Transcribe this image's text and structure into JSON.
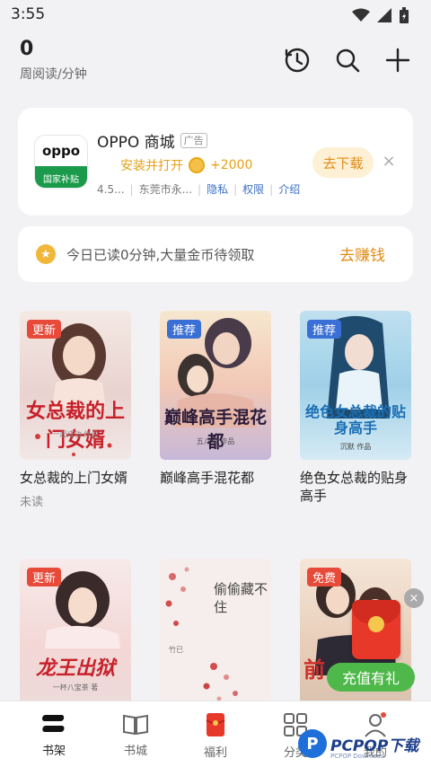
{
  "status_bar": {
    "time": "3:55"
  },
  "header": {
    "weekly_count": "0",
    "weekly_label": "周阅读/分钟",
    "history_icon": "history-clock-icon",
    "search_icon": "search-icon",
    "add_icon": "plus-icon"
  },
  "ad": {
    "logo_text": "oppo",
    "logo_sub": "国家补贴",
    "title": "OPPO 商城",
    "tag": "广告",
    "install_text": "安装并打开",
    "bonus": "+2000",
    "rating": "4.5...",
    "developer": "东莞市永...",
    "privacy": "隐私",
    "permissions": "权限",
    "intro": "介绍",
    "download": "去下载",
    "close": "×"
  },
  "earn": {
    "text": "今日已读0分钟,大量金币待领取",
    "button": "去赚钱"
  },
  "books": [
    {
      "badge": "更新",
      "cover_title": "女总裁的上门女婿",
      "cover_author": "一起成功 作品",
      "title": "女总裁的上门女婿",
      "status": "未读"
    },
    {
      "badge": "推荐",
      "cover_title": "巅峰高手混花都",
      "cover_author": "五八山 作品",
      "title": "巅峰高手混花都",
      "status": ""
    },
    {
      "badge": "推荐",
      "cover_title": "绝色女总裁的贴身高手",
      "cover_author": "沉默 作品",
      "title": "绝色女总裁的贴身高手",
      "status": ""
    },
    {
      "badge": "更新",
      "cover_title": "龙王出狱",
      "cover_author": "一杯八宝茶 著",
      "title": "",
      "status": ""
    },
    {
      "badge": "",
      "cover_title": "偷偷藏不住",
      "cover_author": "竹已",
      "title": "",
      "status": ""
    },
    {
      "badge": "免费",
      "cover_title": "前",
      "cover_author": "",
      "title": "",
      "status": ""
    }
  ],
  "floating": {
    "recharge": "充值有礼",
    "close": "×"
  },
  "tabs": [
    {
      "label": "书架",
      "icon": "bookshelf-icon",
      "active": true
    },
    {
      "label": "书城",
      "icon": "open-book-icon"
    },
    {
      "label": "福利",
      "icon": "red-envelope-icon"
    },
    {
      "label": "分类",
      "icon": "grid-icon"
    },
    {
      "label": "我的",
      "icon": "profile-icon"
    }
  ],
  "watermark": {
    "logo": "P",
    "text": "PCPOP下载",
    "sub": "PCPOP Download"
  },
  "colors": {
    "accent": "#e08c16",
    "link": "#3a6fc5",
    "badge_red": "#e84a3a",
    "badge_blue": "#3a6fd5",
    "green": "#4fb84a"
  }
}
